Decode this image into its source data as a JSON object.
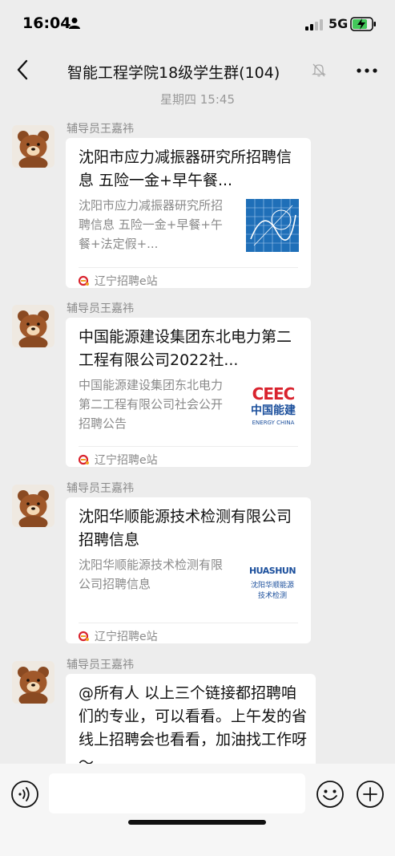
{
  "status_bar": {
    "time": "16:04",
    "network": "5G"
  },
  "nav": {
    "title": "智能工程学院18级学生群(104)"
  },
  "timestamp": "星期四 15:45",
  "messages": [
    {
      "sender": "辅导员王嘉祎",
      "title": "沈阳市应力减振器研究所招聘信息 五险一金+早午餐...",
      "desc": "沈阳市应力减振器研究所招聘信息 五险一金+早餐+午餐+法定假+...",
      "source": "辽宁招聘e站"
    },
    {
      "sender": "辅导员王嘉祎",
      "title": "中国能源建设集团东北电力第二工程有限公司2022社...",
      "desc": "中国能源建设集团东北电力第二工程有限公司社会公开招聘公告",
      "source": "辽宁招聘e站",
      "logo_main": "CEEC",
      "logo_cn": "中国能建",
      "logo_en": "ENERGY CHINA"
    },
    {
      "sender": "辅导员王嘉祎",
      "title": "沈阳华顺能源技术检测有限公司招聘信息",
      "desc": "沈阳华顺能源技术检测有限公司招聘信息",
      "source": "辽宁招聘e站",
      "logo_main": "HUASHUN",
      "logo_cn_line1": "沈阳华顺能源",
      "logo_cn_line2": "技术检测"
    },
    {
      "sender": "辅导员王嘉祎",
      "text": "@所有人 以上三个链接都招聘咱们的专业，可以看看。上午发的省线上招聘会也看看，加油找工作呀～"
    }
  ],
  "input": {
    "value": "",
    "placeholder": ""
  },
  "colors": {
    "accent_red": "#d9232e",
    "energy_blue": "#1b4f9c",
    "bubble_bg": "#ffffff",
    "chat_bg": "#ededed"
  }
}
